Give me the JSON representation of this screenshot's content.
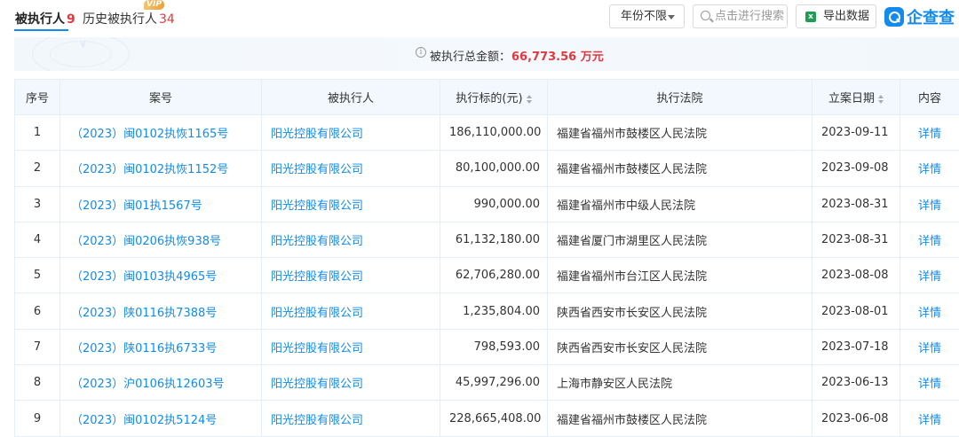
{
  "tabs": {
    "executed": {
      "label": "被执行人",
      "count": "9"
    },
    "history": {
      "label": "历史被执行人",
      "count": "34",
      "badge": "VIP"
    }
  },
  "toolbar": {
    "year_filter": "年份不限",
    "search_placeholder": "点击进行搜索",
    "export_label": "导出数据",
    "logo_text": "企查查"
  },
  "summary": {
    "label": "被执行总金额：",
    "amount": "66,773.56 万元"
  },
  "table": {
    "headers": [
      "序号",
      "案号",
      "被执行人",
      "执行标的(元)",
      "执行法院",
      "立案日期",
      "内容"
    ],
    "detail_label": "详情",
    "rows": [
      {
        "idx": "1",
        "case": "（2023）闽0102执恢1165号",
        "party": "阳光控股有限公司",
        "amount": "186,110,000.00",
        "court": "福建省福州市鼓楼区人民法院",
        "date": "2023-09-11"
      },
      {
        "idx": "2",
        "case": "（2023）闽0102执恢1152号",
        "party": "阳光控股有限公司",
        "amount": "80,100,000.00",
        "court": "福建省福州市鼓楼区人民法院",
        "date": "2023-09-08"
      },
      {
        "idx": "3",
        "case": "（2023）闽01执1567号",
        "party": "阳光控股有限公司",
        "amount": "990,000.00",
        "court": "福建省福州市中级人民法院",
        "date": "2023-08-31"
      },
      {
        "idx": "4",
        "case": "（2023）闽0206执恢938号",
        "party": "阳光控股有限公司",
        "amount": "61,132,180.00",
        "court": "福建省厦门市湖里区人民法院",
        "date": "2023-08-31"
      },
      {
        "idx": "5",
        "case": "（2023）闽0103执4965号",
        "party": "阳光控股有限公司",
        "amount": "62,706,280.00",
        "court": "福建省福州市台江区人民法院",
        "date": "2023-08-08"
      },
      {
        "idx": "6",
        "case": "（2023）陕0116执7388号",
        "party": "阳光控股有限公司",
        "amount": "1,235,804.00",
        "court": "陕西省西安市长安区人民法院",
        "date": "2023-08-01"
      },
      {
        "idx": "7",
        "case": "（2023）陕0116执6733号",
        "party": "阳光控股有限公司",
        "amount": "798,593.00",
        "court": "陕西省西安市长安区人民法院",
        "date": "2023-07-18"
      },
      {
        "idx": "8",
        "case": "（2023）沪0106执12603号",
        "party": "阳光控股有限公司",
        "amount": "45,997,296.00",
        "court": "上海市静安区人民法院",
        "date": "2023-06-13"
      },
      {
        "idx": "9",
        "case": "（2023）闽0102执5124号",
        "party": "阳光控股有限公司",
        "amount": "228,665,408.00",
        "court": "福建省福州市鼓楼区人民法院",
        "date": "2023-06-08"
      }
    ]
  },
  "colors": {
    "accent": "#128bed",
    "highlight": "#e0393e",
    "header_bg": "#f2f8fe"
  }
}
